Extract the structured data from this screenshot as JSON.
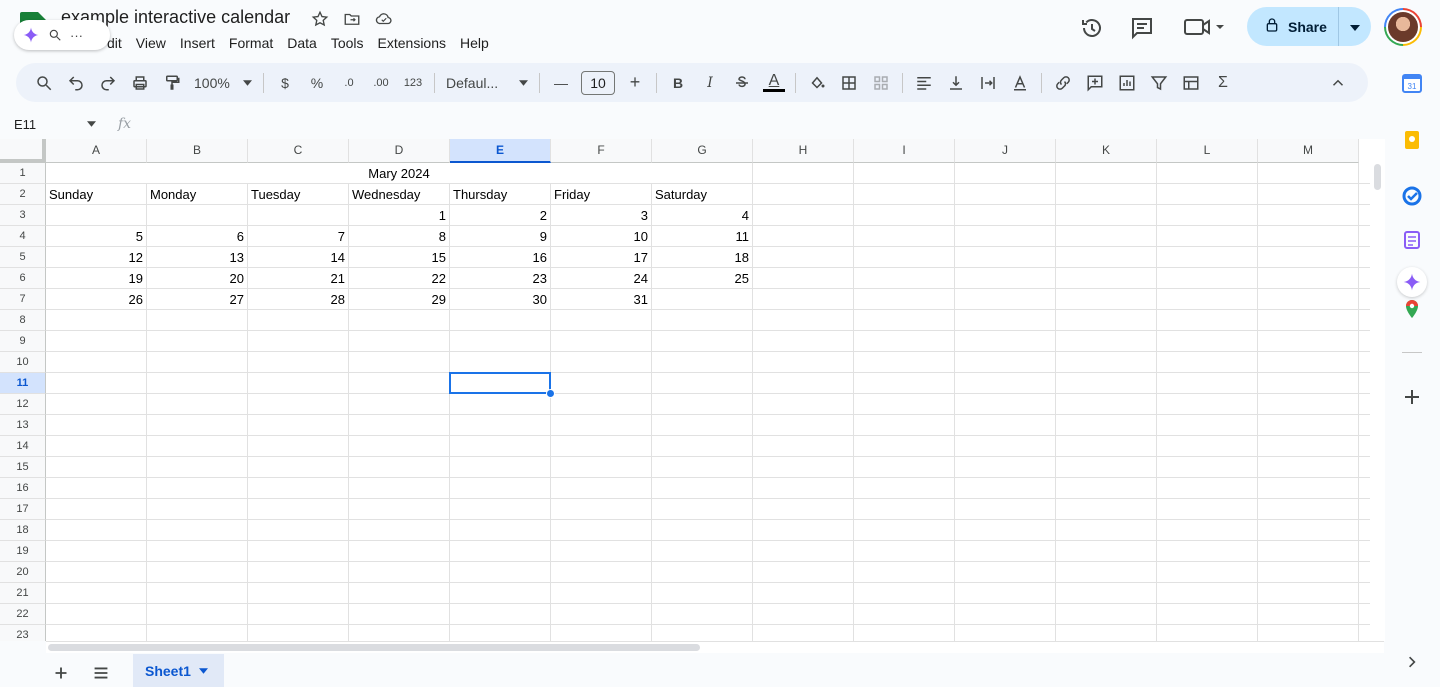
{
  "document": {
    "title": "example interactive calendar"
  },
  "menu": [
    "Edit",
    "View",
    "Insert",
    "Format",
    "Data",
    "Tools",
    "Extensions",
    "Help"
  ],
  "menu_first_partial": "dit",
  "header": {
    "share_label": "Share"
  },
  "toolbar": {
    "zoom": "100%",
    "currency": "$",
    "percent": "%",
    "decrease_decimal": ".0",
    "increase_decimal": ".00",
    "number_format": "123",
    "font": "Defaul...",
    "font_size": "10",
    "bold": "B",
    "italic": "I",
    "text_color_glyph": "A",
    "sigma": "Σ"
  },
  "formula_bar": {
    "cell_ref": "E11",
    "fx": "fx"
  },
  "columns": [
    "A",
    "B",
    "C",
    "D",
    "E",
    "F",
    "G",
    "H",
    "I",
    "J",
    "K",
    "L",
    "M"
  ],
  "selected_column": "E",
  "rows": [
    "1",
    "2",
    "3",
    "4",
    "5",
    "6",
    "7",
    "8",
    "9",
    "10",
    "11",
    "12",
    "13",
    "14",
    "15",
    "16",
    "17",
    "18",
    "19",
    "20",
    "21",
    "22",
    "23"
  ],
  "selected_row": "11",
  "sheet": {
    "month_title": "Mary 2024",
    "weekdays": [
      "Sunday",
      "Monday",
      "Tuesday",
      "Wednesday",
      "Thursday",
      "Friday",
      "Saturday"
    ],
    "weeks": [
      [
        "",
        "",
        "",
        "1",
        "2",
        "3",
        "4"
      ],
      [
        "5",
        "6",
        "7",
        "8",
        "9",
        "10",
        "11"
      ],
      [
        "12",
        "13",
        "14",
        "15",
        "16",
        "17",
        "18"
      ],
      [
        "19",
        "20",
        "21",
        "22",
        "23",
        "24",
        "25"
      ],
      [
        "26",
        "27",
        "28",
        "29",
        "30",
        "31",
        ""
      ]
    ]
  },
  "tabs": {
    "active": "Sheet1"
  },
  "side_panel": {
    "calendar_day": "31"
  },
  "colors": {
    "accent": "#0b57d0",
    "share_bg": "#c2e7ff",
    "selection": "#1a73e8"
  }
}
